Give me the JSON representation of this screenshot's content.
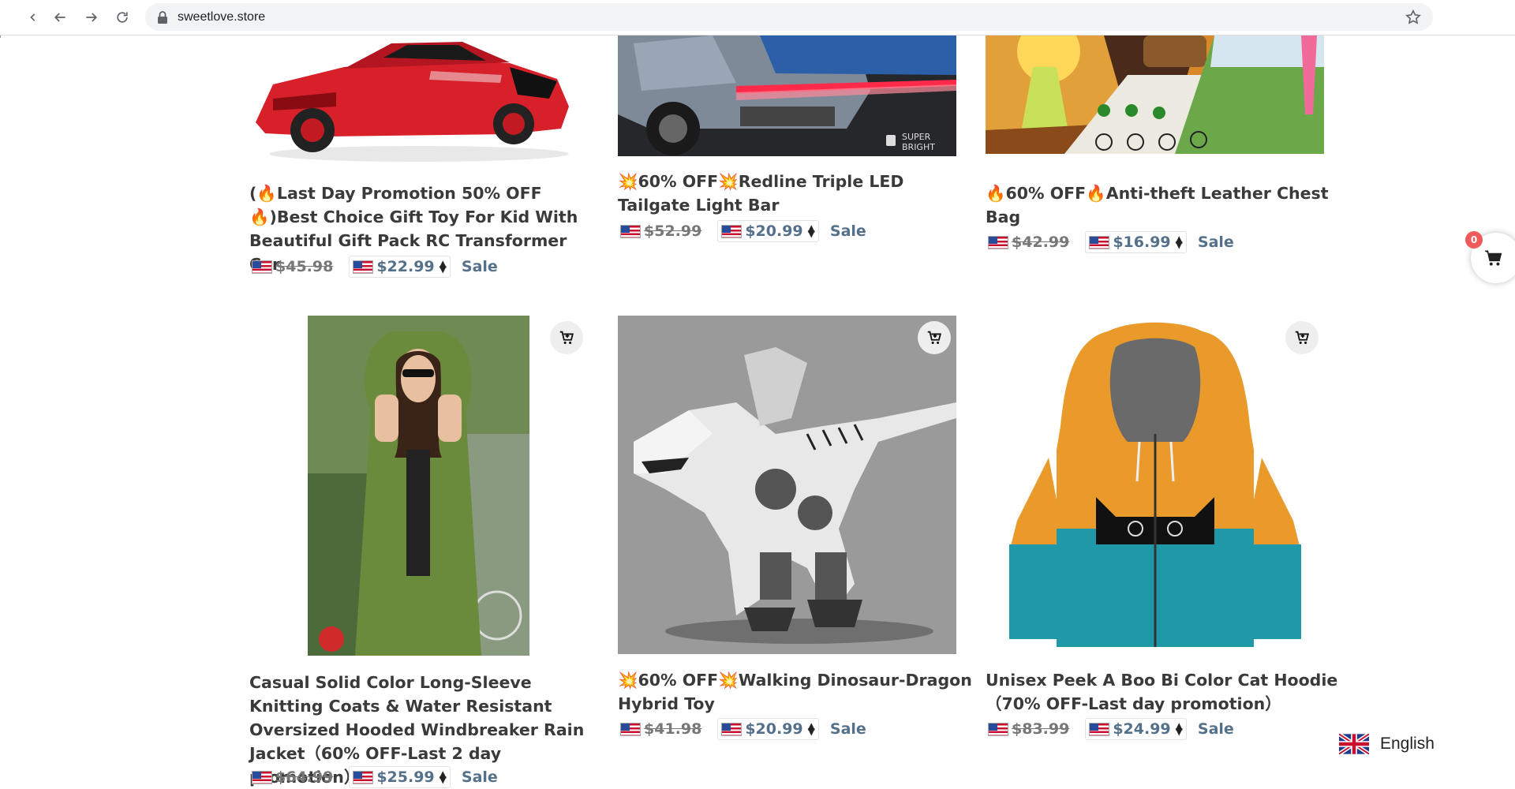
{
  "browser": {
    "url": "sweetlove.store",
    "icons": [
      "chevron-left-icon",
      "back-arrow-icon",
      "forward-arrow-icon",
      "reload-icon",
      "lock-icon",
      "bookmark-star-icon"
    ]
  },
  "products": [
    {
      "title_parts": [
        "(",
        "🔥",
        "Last Day Promotion 50% OFF",
        "🔥",
        ")Best Choice Gift Toy For Kid With Beautiful Gift Pack RC Transformer Car"
      ],
      "old_price": "$45.98",
      "new_price": "$22.99",
      "sale": "Sale"
    },
    {
      "title_parts": [
        "💥",
        "60% OFF",
        "💥",
        "Redline Triple LED Tailgate Light Bar"
      ],
      "old_price": "$52.99",
      "new_price": "$20.99",
      "sale": "Sale"
    },
    {
      "title_parts": [
        "🔥",
        "60% OFF",
        "🔥",
        "Anti-theft Leather Chest Bag"
      ],
      "old_price": "$42.99",
      "new_price": "$16.99",
      "sale": "Sale"
    },
    {
      "title": "Casual Solid Color Long-Sleeve Knitting Coats & Water Resistant Oversized Hooded Windbreaker Rain Jacket（60% OFF-Last 2 day promotion）",
      "old_price": "$64.99",
      "new_price": "$25.99",
      "sale": "Sale"
    },
    {
      "title_parts": [
        "💥",
        "60% OFF",
        "💥",
        "Walking Dinosaur-Dragon Hybrid Toy"
      ],
      "old_price": "$41.98",
      "new_price": "$20.99",
      "sale": "Sale"
    },
    {
      "title": "Unisex Peek A Boo Bi Color Cat Hoodie（70% OFF-Last day promotion）",
      "old_price": "$83.99",
      "new_price": "$24.99",
      "sale": "Sale"
    }
  ],
  "cart": {
    "count": "0"
  },
  "language": {
    "label": "English"
  },
  "colors": {
    "price": "#55708a",
    "badge": "#f05a5a"
  }
}
